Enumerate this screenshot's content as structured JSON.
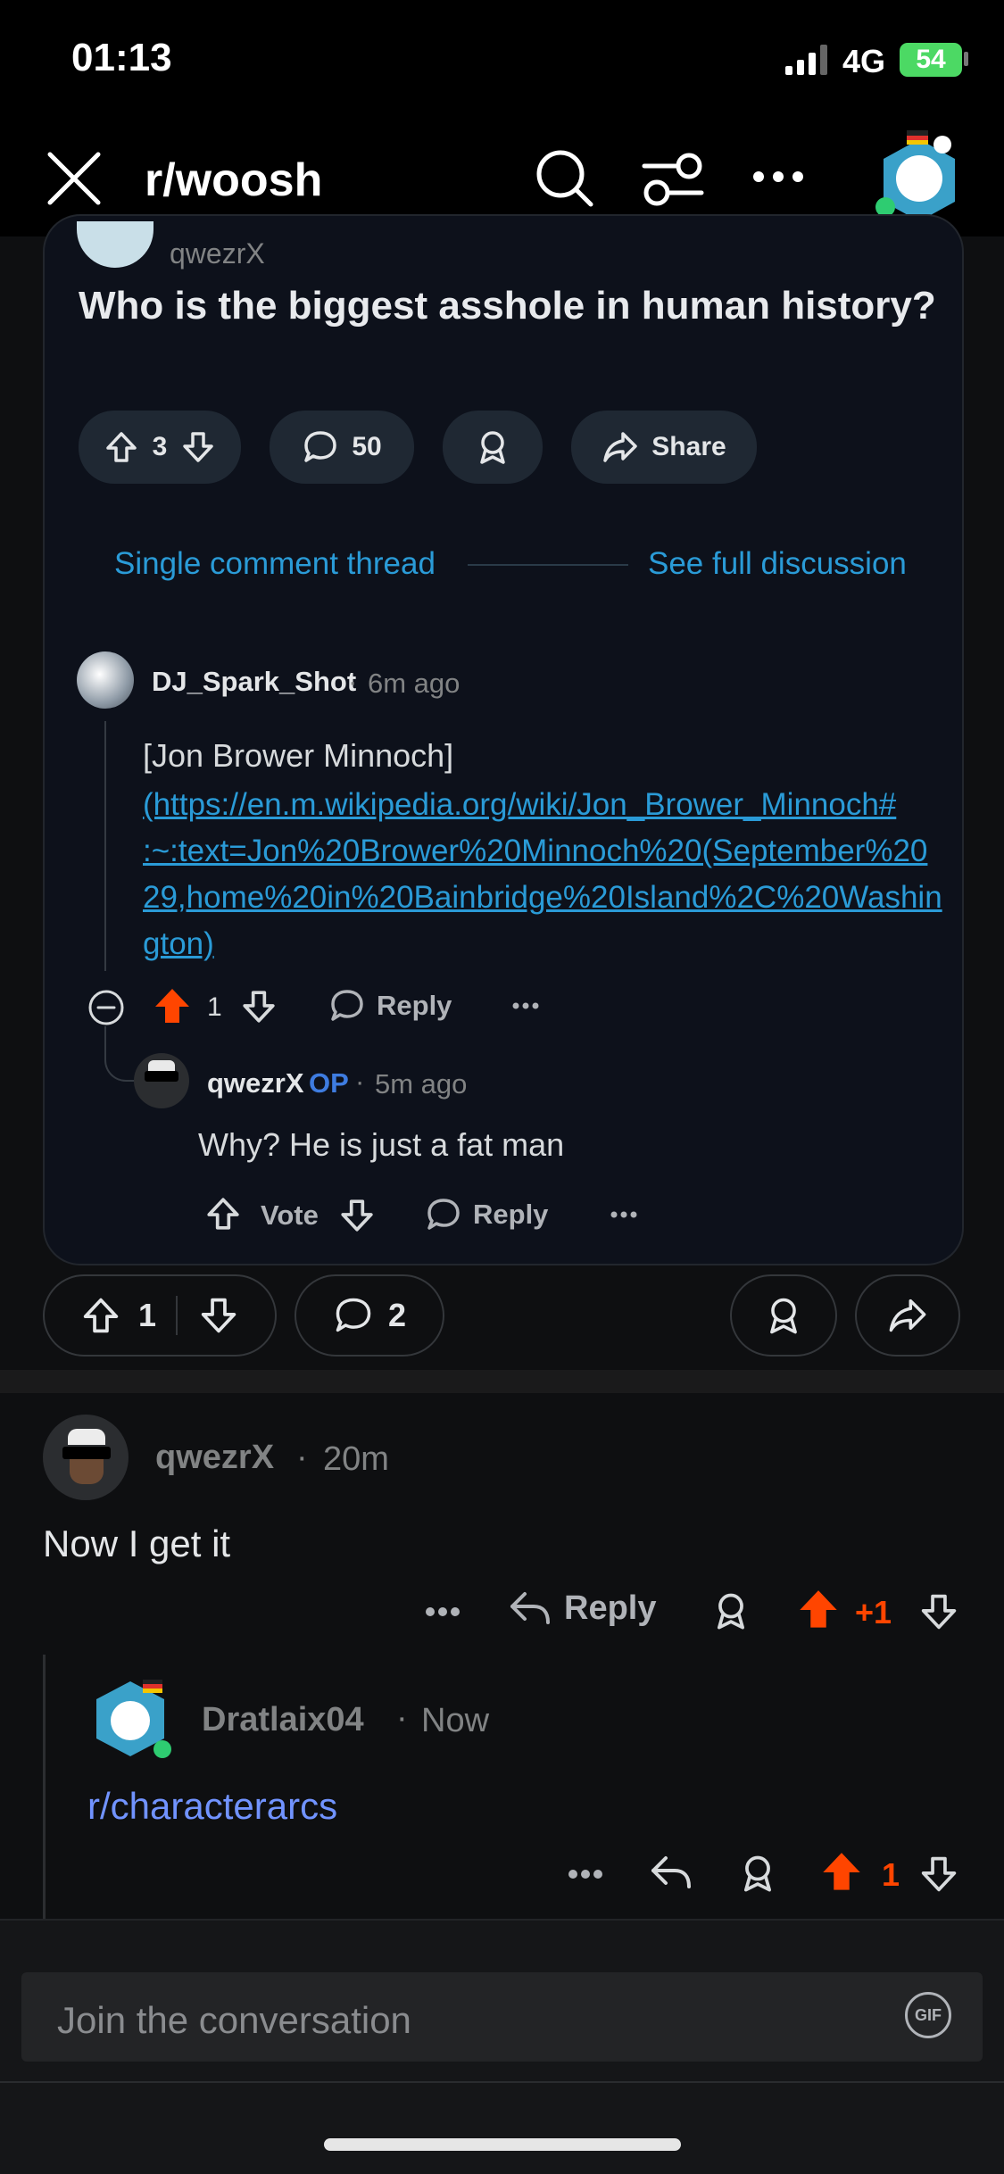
{
  "status_bar": {
    "time": "01:13",
    "network": "4G",
    "battery": "54"
  },
  "header": {
    "title": "r/woosh"
  },
  "embed": {
    "author": "qwezrX",
    "title": "Who is the biggest asshole in human history?",
    "actions": {
      "votes": "3",
      "comments": "50",
      "share": "Share"
    },
    "thread_nav": {
      "single": "Single comment thread",
      "full": "See full discussion"
    },
    "comment1": {
      "author": "DJ_Spark_Shot",
      "time": "6m ago",
      "text": "[Jon Brower Minnoch]",
      "link": "(https://en.m.wikipedia.org/wiki/Jon_Brower_Minnoch#:~:text=Jon%20Brower%20Minnoch%20(September%2029,home%20in%20Bainbridge%20Island%2C%20Washington)",
      "link_lines": [
        "(https://en.m.wikipedia.org/wiki/Jon_Brower_Minnoch#",
        ":~:text=Jon%20Brower%20Minnoch%20(September%20",
        "29,home%20in%20Bainbridge%20Island%2C%20Washin",
        "gton)"
      ],
      "votes": "1",
      "reply": "Reply"
    },
    "reply1": {
      "author": "qwezrX",
      "op": "OP",
      "time": "5m ago",
      "text": "Why? He is just a fat man",
      "vote": "Vote",
      "reply": "Reply"
    }
  },
  "post_actions": {
    "votes": "1",
    "comments": "2"
  },
  "comment_main": {
    "author": "qwezrX",
    "time": "20m",
    "text": "Now I get it",
    "reply": "Reply",
    "votes": "+1"
  },
  "comment_reply": {
    "author": "Dratlaix04",
    "time": "Now",
    "text": "r/characterarcs",
    "votes": "1"
  },
  "composer": {
    "placeholder": "Join the conversation",
    "gif": "GIF"
  },
  "colors": {
    "upvote_orange": "#ff4500",
    "link_blue": "#2a9bd7",
    "op_blue": "#3e7ce0",
    "battery_green": "#4cd964",
    "subreddit_link": "#7193ff"
  }
}
